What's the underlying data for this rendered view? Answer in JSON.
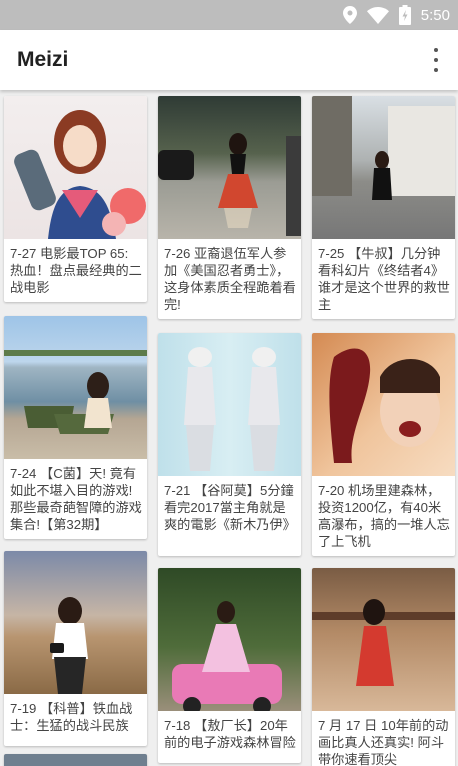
{
  "status_bar": {
    "time": "5:50",
    "icons": [
      "location-icon",
      "wifi-icon",
      "battery-icon"
    ]
  },
  "app_bar": {
    "title": "Meizi",
    "menu_icon": "more-vert-icon"
  },
  "cards": [
    {
      "caption": "7-27  电影最TOP 65: 热血！盘点最经典的二战电影"
    },
    {
      "caption": "7-26  亚裔退伍军人参加《美国忍者勇士》，这身体素质全程跪着看完!"
    },
    {
      "caption": "7-25  【牛叔】几分钟看科幻片《终结者4》谁才是这个世界的救世主"
    },
    {
      "caption": "7-24  【C菌】天! 竟有如此不堪入目的游戏! 那些最奇葩智障的游戏集合!【第32期】"
    },
    {
      "caption": "7-21  【谷阿莫】5分鐘看完2017當主角就是爽的電影《新木乃伊》"
    },
    {
      "caption": "7-20  机场里建森林，投资1200亿，有40米高瀑布，搞的一堆人忘了上飞机"
    },
    {
      "caption": "7-19  【科普】铁血战士：生猛的战斗民族"
    },
    {
      "caption": "7-18  【敖厂长】20年前的电子游戏森林冒险"
    },
    {
      "caption": "7 月 17 日  10年前的动画比真人还真实! 阿斗带你速看顶尖"
    }
  ]
}
